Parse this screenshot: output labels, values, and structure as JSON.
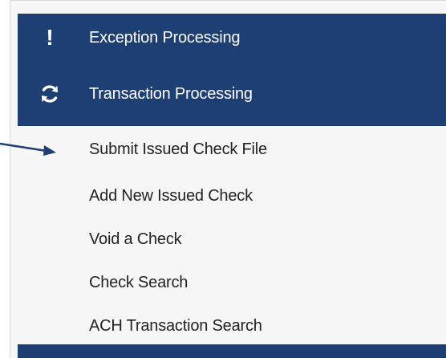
{
  "menu": {
    "sections": [
      {
        "label": "Exception Processing",
        "icon": "exclamation-icon"
      },
      {
        "label": "Transaction Processing",
        "icon": "refresh-icon"
      }
    ],
    "submenu": [
      "Submit Issued Check File",
      "Add New Issued Check",
      "Void a Check",
      "Check Search",
      "ACH Transaction Search"
    ]
  },
  "colors": {
    "header_bg": "#1e3f74",
    "submenu_bg": "#f7f7f7",
    "arrow": "#1e3f74"
  }
}
